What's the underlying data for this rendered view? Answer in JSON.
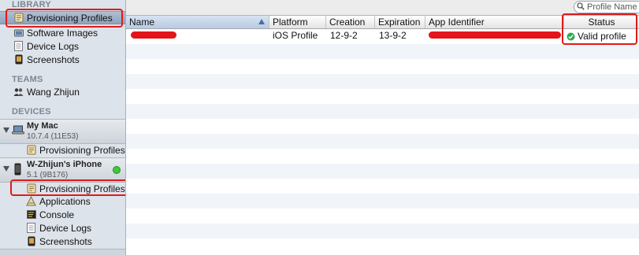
{
  "sidebar": {
    "library_header": "LIBRARY",
    "library_items": [
      {
        "label": "Provisioning Profiles",
        "icon": "provisioning-profile-icon",
        "selected": true
      },
      {
        "label": "Software Images",
        "icon": "software-images-icon"
      },
      {
        "label": "Device Logs",
        "icon": "device-logs-icon"
      },
      {
        "label": "Screenshots",
        "icon": "screenshots-icon"
      }
    ],
    "teams_header": "TEAMS",
    "team_items": [
      {
        "label": "Wang Zhijun",
        "icon": "team-people-icon"
      }
    ],
    "devices_header": "DEVICES",
    "devices": [
      {
        "name": "My Mac",
        "version": "10.7.4 (11E53)",
        "icon": "laptop-icon",
        "children": [
          {
            "label": "Provisioning Profiles",
            "icon": "provisioning-profile-icon"
          }
        ]
      },
      {
        "name": "W-Zhijun's iPhone",
        "version": "5.1 (9B176)",
        "icon": "iphone-icon",
        "status_color": "#3cc93c",
        "children": [
          {
            "label": "Provisioning Profiles",
            "icon": "provisioning-profile-icon"
          },
          {
            "label": "Applications",
            "icon": "applications-icon"
          },
          {
            "label": "Console",
            "icon": "console-icon"
          },
          {
            "label": "Device Logs",
            "icon": "device-logs-icon"
          },
          {
            "label": "Screenshots",
            "icon": "screenshots-icon"
          }
        ]
      }
    ]
  },
  "search": {
    "placeholder": "Profile Name"
  },
  "table": {
    "columns": [
      "Name",
      "Platform",
      "Creation",
      "Expiration",
      "App Identifier",
      "Status"
    ],
    "sorted_column": "Name",
    "rows": [
      {
        "name": "",
        "platform": "iOS Profile",
        "creation": "12-9-2",
        "expiration": "13-9-2",
        "app_identifier": "",
        "status": "Valid profile",
        "status_icon": "check-circle-icon"
      }
    ]
  },
  "colors": {
    "highlight_red": "#e01a1a",
    "valid_green": "#2fa84f",
    "selection_blue": "#8ea3bb"
  }
}
